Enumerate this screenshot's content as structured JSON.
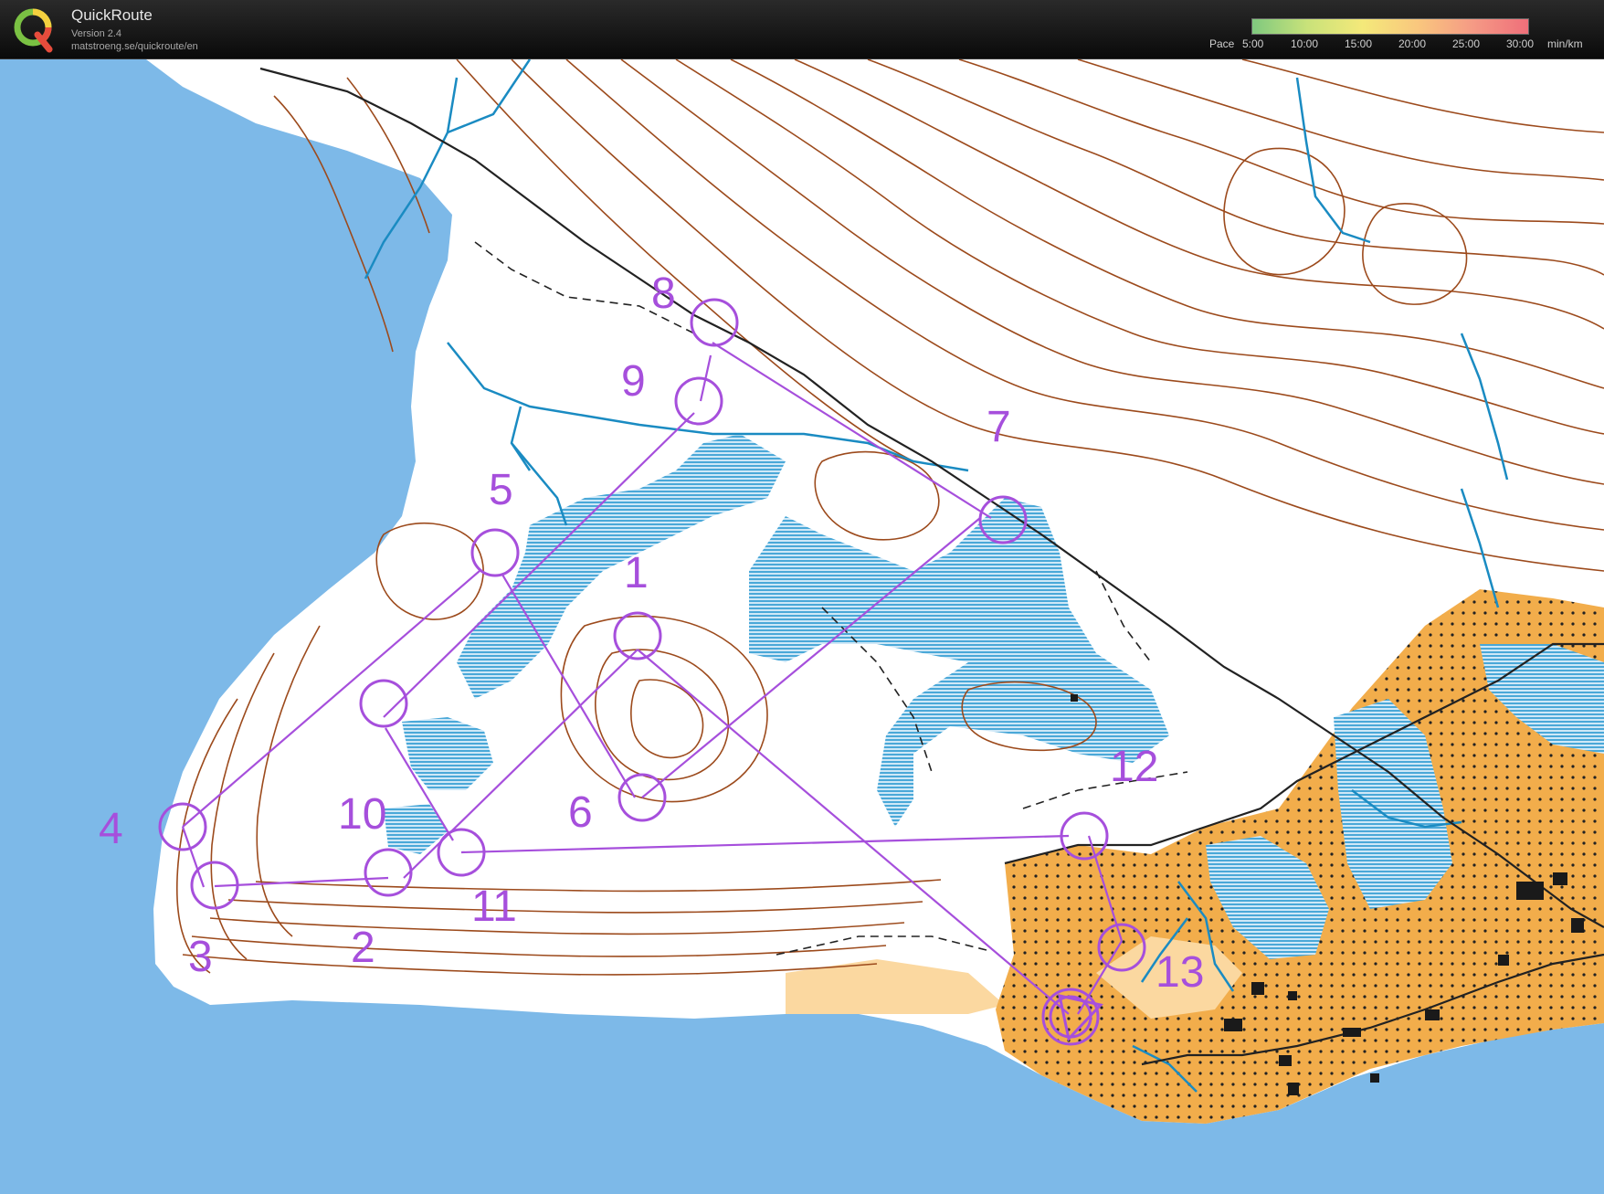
{
  "app": {
    "title": "QuickRoute",
    "version": "Version 2.4",
    "url": "matstroeng.se/quickroute/en"
  },
  "pace_legend": {
    "label": "Pace",
    "ticks": [
      "5:00",
      "10:00",
      "15:00",
      "20:00",
      "25:00",
      "30:00"
    ],
    "unit": "min/km",
    "gradient_colors": [
      "#7fc97f",
      "#c9e27a",
      "#f4e97a",
      "#f9c77e",
      "#f59a85",
      "#ef6f7a"
    ]
  },
  "map": {
    "colors": {
      "water": "#7db9e8",
      "marsh": "#4aa8d8",
      "land": "#ffffff",
      "contour": "#9c4a1c",
      "open_land": "#f7c77a",
      "rough_open": "#fbd8a0",
      "course": "#a64fdc",
      "track": "#222222"
    },
    "controls": [
      {
        "label": "1"
      },
      {
        "label": "2"
      },
      {
        "label": "3"
      },
      {
        "label": "4"
      },
      {
        "label": "5"
      },
      {
        "label": "6"
      },
      {
        "label": "7"
      },
      {
        "label": "8"
      },
      {
        "label": "9"
      },
      {
        "label": "10"
      },
      {
        "label": "11"
      },
      {
        "label": "12"
      },
      {
        "label": "13"
      }
    ]
  }
}
